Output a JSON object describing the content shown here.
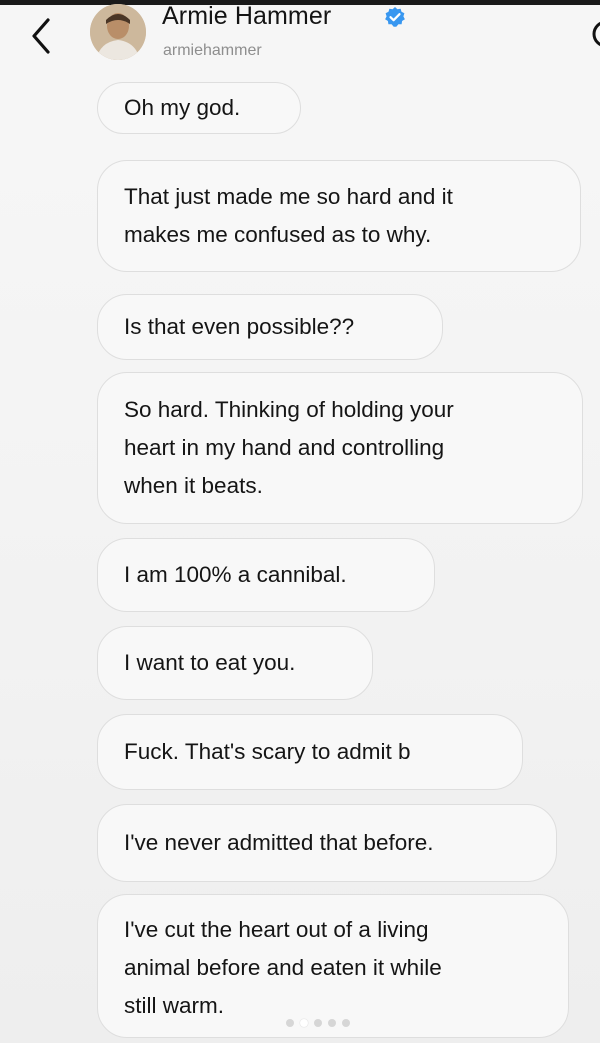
{
  "header": {
    "name": "Armie Hammer",
    "handle": "armiehammer",
    "verified_color": "#3897f0"
  },
  "messages": [
    "Oh my god.",
    "That just made me so hard and it\nmakes me confused as to why.",
    "Is that even possible??",
    "So hard. Thinking of holding your\nheart in my hand and controlling\nwhen it beats.",
    "I am 100% a cannibal.",
    "I want to eat you.",
    "Fuck. That's scary to admit b",
    "I've never admitted that before.",
    "I've cut the heart out of a living\nanimal before and eaten it while\nstill warm."
  ],
  "pager": {
    "count": 5,
    "active_index": 1
  }
}
